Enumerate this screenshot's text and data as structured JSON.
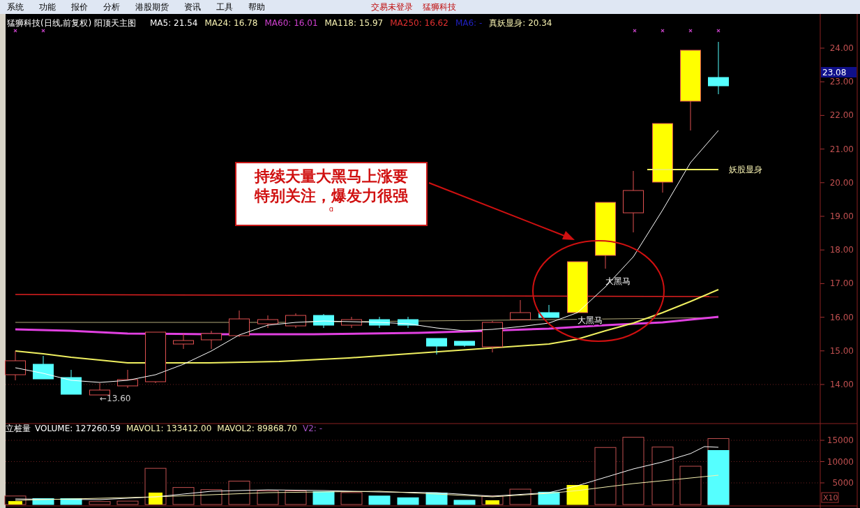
{
  "menu": [
    "系统",
    "功能",
    "报价",
    "分析",
    "港股期货",
    "资讯",
    "工具",
    "帮助"
  ],
  "status": [
    "交易未登录",
    "猛狮科技"
  ],
  "price_chart": {
    "title": "猛狮科技(日线,前复权) 阳顶天主图",
    "indicators": [
      {
        "text": "MA5: 21.54",
        "color": "#ffffff"
      },
      {
        "text": "MA24: 16.78",
        "color": "#f5f0b0"
      },
      {
        "text": "MA60: 16.01",
        "color": "#d040d0"
      },
      {
        "text": "MA118: 15.97",
        "color": "#f5f0b0"
      },
      {
        "text": "MA250: 16.62",
        "color": "#e03030"
      },
      {
        "text": "MA6: -",
        "color": "#2020c0"
      },
      {
        "text": "真妖显身: 20.34",
        "color": "#f5f0b0"
      }
    ],
    "y_axis_labels": [
      "24.00",
      "23.00",
      "22.00",
      "21.00",
      "20.00",
      "19.00",
      "18.00",
      "17.00",
      "16.00",
      "15.00",
      "14.00"
    ],
    "last_price": "23.08",
    "low_marker": "←13.60",
    "callout": {
      "text": "持续天量大黑马上涨要特别关注，爆发力很强",
      "note": "ɑ"
    },
    "candle_labels": [
      "大黑马",
      "大黑马"
    ],
    "signal_label": "妖股显身"
  },
  "volume_chart": {
    "title": "立桩量",
    "indicators": [
      {
        "text": "VOLUME: 127260.59",
        "color": "#ffffff"
      },
      {
        "text": "MAVOL1: 133412.00",
        "color": "#f5f0b0"
      },
      {
        "text": "MAVOL2: 89868.70",
        "color": "#f5f0b0"
      },
      {
        "text": "V2: -",
        "color": "#a050c0"
      }
    ],
    "y_axis_labels": [
      "15000",
      "10000",
      "5000"
    ],
    "scale": "X10"
  }
}
